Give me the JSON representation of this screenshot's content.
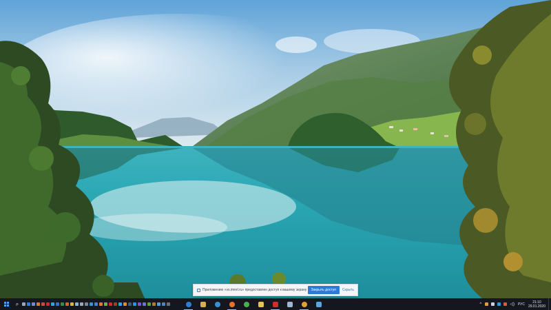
{
  "notification": {
    "message": "Приложению «vs.imrel.ru» предоставлен доступ к вашему экрану",
    "stop_label": "Закрыть доступ",
    "hide_label": "Скрыть"
  },
  "taskbar": {
    "start_icon": "windows-logo-icon",
    "search_icon": "search-icon",
    "quick_launch": [
      {
        "name": "ql-file-explorer",
        "color": "#9aa7b4"
      },
      {
        "name": "ql-task-view",
        "color": "#2f7fd1"
      },
      {
        "name": "ql-mail",
        "color": "#6b8fc6"
      },
      {
        "name": "ql-firefox",
        "color": "#e9732b"
      },
      {
        "name": "ql-chrome",
        "color": "#d4463a"
      },
      {
        "name": "ql-opera",
        "color": "#d22a2a"
      },
      {
        "name": "ql-skype",
        "color": "#2ba5e5"
      },
      {
        "name": "ql-word",
        "color": "#3d6fc4"
      },
      {
        "name": "ql-excel",
        "color": "#2f8d4e"
      },
      {
        "name": "ql-powerpoint",
        "color": "#d2662f"
      },
      {
        "name": "ql-folder",
        "color": "#d6b24d"
      },
      {
        "name": "ql-notepad",
        "color": "#8fb1d4"
      },
      {
        "name": "ql-settings",
        "color": "#a0a8b0"
      },
      {
        "name": "ql-calculator",
        "color": "#7d8690"
      },
      {
        "name": "ql-photos",
        "color": "#3b8ed8"
      },
      {
        "name": "ql-store",
        "color": "#4c7fc9"
      },
      {
        "name": "ql-media",
        "color": "#e07a2f"
      },
      {
        "name": "ql-paint",
        "color": "#6fb14f"
      },
      {
        "name": "ql-acrobat",
        "color": "#c9302c"
      },
      {
        "name": "ql-filezilla",
        "color": "#b2332b"
      },
      {
        "name": "ql-telegram",
        "color": "#2ea4dc"
      },
      {
        "name": "ql-vlc",
        "color": "#ee8a1a"
      },
      {
        "name": "ql-steam",
        "color": "#3d5a78"
      },
      {
        "name": "ql-zoom",
        "color": "#2d8cff"
      },
      {
        "name": "ql-viber",
        "color": "#7d53c7"
      },
      {
        "name": "ql-discord",
        "color": "#6974d8"
      },
      {
        "name": "ql-torrent",
        "color": "#5aa13f"
      },
      {
        "name": "ql-archive",
        "color": "#a77c3d"
      },
      {
        "name": "ql-network",
        "color": "#5c9cd6"
      },
      {
        "name": "ql-defender",
        "color": "#4a87c7"
      },
      {
        "name": "ql-terminal",
        "color": "#6b7178"
      }
    ],
    "pinned_apps": [
      {
        "name": "taskbar-app-edge",
        "color": "#2f7fd1",
        "round": true,
        "active": true
      },
      {
        "name": "taskbar-app-explorer",
        "color": "#d6b24d",
        "round": false,
        "active": false
      },
      {
        "name": "taskbar-app-ie",
        "color": "#3b8ed8",
        "round": true,
        "active": false
      },
      {
        "name": "taskbar-app-firefox",
        "color": "#e9732b",
        "round": true,
        "active": true
      },
      {
        "name": "taskbar-app-chrome",
        "color": "#4caf50",
        "round": true,
        "active": false
      },
      {
        "name": "taskbar-app-explorer-2",
        "color": "#e6c35a",
        "round": false,
        "active": false
      },
      {
        "name": "taskbar-app-acrobat",
        "color": "#c9302c",
        "round": false,
        "active": true
      },
      {
        "name": "taskbar-app-notes",
        "color": "#9fb7d0",
        "round": false,
        "active": false
      },
      {
        "name": "taskbar-app-chrome-2",
        "color": "#e0a03a",
        "round": true,
        "active": true
      },
      {
        "name": "taskbar-app-monitor",
        "color": "#5aa7e0",
        "round": false,
        "active": false
      }
    ],
    "tray": {
      "chevron_icon": "chevron-up-icon",
      "tray_squares": [
        {
          "name": "tray-app-1",
          "color": "#e0a03a"
        },
        {
          "name": "tray-app-2",
          "color": "#d0d4d8"
        },
        {
          "name": "tray-app-3",
          "color": "#2e9be0"
        },
        {
          "name": "tray-app-4",
          "color": "#e05a3a"
        }
      ],
      "volume_icon": "speaker-icon",
      "language": "РУС",
      "time": "21:10",
      "date": "29.01.2020"
    }
  }
}
